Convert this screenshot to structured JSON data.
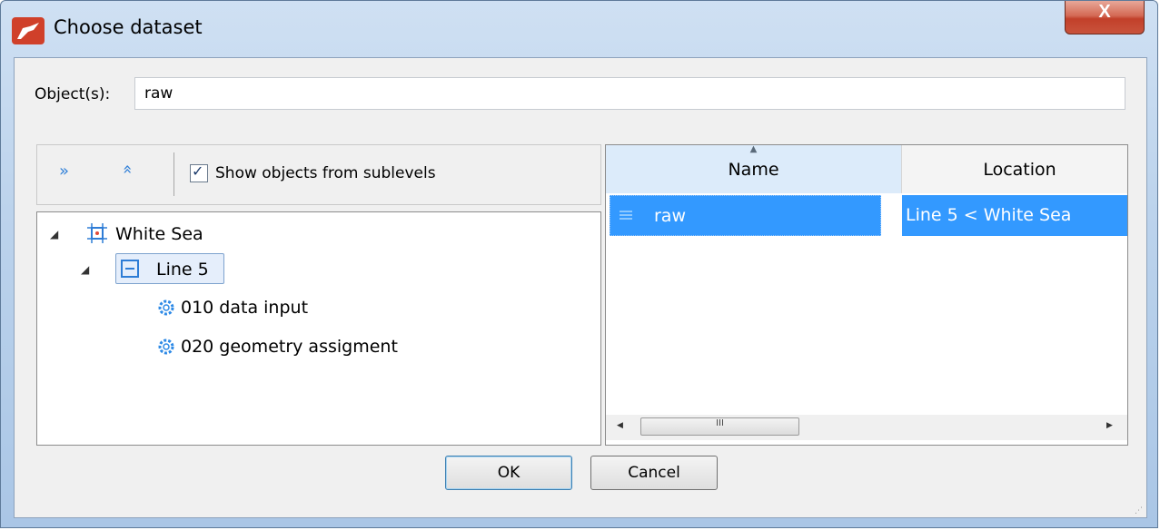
{
  "window": {
    "title": "Choose dataset",
    "close_glyph": "X"
  },
  "objects": {
    "label": "Object(s):",
    "value": "raw"
  },
  "toolbar": {
    "expand_all_glyph": "»",
    "collapse_all_glyph": "«",
    "show_sublevels_label": "Show objects from sublevels",
    "show_sublevels_checked": true
  },
  "tree": {
    "root": {
      "label": "White Sea",
      "icon": "project-icon",
      "expanded": true
    },
    "child": {
      "label": "Line 5",
      "icon": "line-icon",
      "expanded": true,
      "selected": true
    },
    "leaves": [
      {
        "label": "010 data input",
        "icon": "gear-icon"
      },
      {
        "label": "020 geometry assigment",
        "icon": "gear-icon"
      }
    ]
  },
  "grid": {
    "columns": [
      "Name",
      "Location"
    ],
    "rows": [
      {
        "name": "raw",
        "location": "Line 5 < White Sea",
        "selected": true
      }
    ],
    "scroll_thumb_glyph": "III"
  },
  "buttons": {
    "ok": "OK",
    "cancel": "Cancel"
  },
  "colors": {
    "selection": "#3399ff",
    "accent": "#2e7dd6",
    "close": "#c2402a"
  }
}
